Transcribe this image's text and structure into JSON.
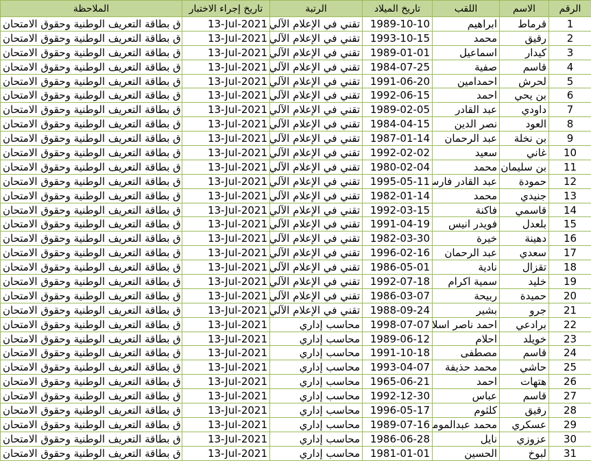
{
  "headers": {
    "note": "الملاحظة",
    "exam_date": "تاريخ إجراء الاختبار",
    "grade": "الرتبة",
    "birth_date": "تاريخ الميلاد",
    "surname": "اللقب",
    "name": "الاسم",
    "number": "الرقم"
  },
  "rows": [
    {
      "note": "ارفاق  بطاقة التعريف  الوطنية وحقوق الامتحان",
      "date": "13-Jul-2021",
      "grade": "تقني في الإعلام الآلي",
      "birth": "1989-10-10",
      "surname": "ابراهيم",
      "name": "قرماط",
      "num": "1"
    },
    {
      "note": "ارفاق  بطاقة التعريف  الوطنية وحقوق الامتحان",
      "date": "13-Jul-2021",
      "grade": "تقني في الإعلام الآلي",
      "birth": "1993-10-15",
      "surname": "محمد",
      "name": "رقيق",
      "num": "2"
    },
    {
      "note": "ارفاق  بطاقة التعريف  الوطنية وحقوق الامتحان",
      "date": "13-Jul-2021",
      "grade": "تقني في الإعلام الآلي",
      "birth": "1989-01-01",
      "surname": "اسماعيل",
      "name": "كيدار",
      "num": "3"
    },
    {
      "note": "ارفاق  بطاقة التعريف  الوطنية وحقوق الامتحان",
      "date": "13-Jul-2021",
      "grade": "تقني في الإعلام الآلي",
      "birth": "1984-07-25",
      "surname": "صفية",
      "name": "قاسم",
      "num": "4"
    },
    {
      "note": "ارفاق  بطاقة التعريف  الوطنية وحقوق الامتحان",
      "date": "13-Jul-2021",
      "grade": "تقني في الإعلام الآلي",
      "birth": "1991-06-20",
      "surname": "احمدامين",
      "name": "لحرش",
      "num": "5"
    },
    {
      "note": "ارفاق  بطاقة التعريف  الوطنية وحقوق الامتحان",
      "date": "13-Jul-2021",
      "grade": "تقني في الإعلام الآلي",
      "birth": "1992-06-15",
      "surname": "احمد",
      "name": "بن يحي",
      "num": "6"
    },
    {
      "note": "ارفاق  بطاقة التعريف  الوطنية وحقوق الامتحان",
      "date": "13-Jul-2021",
      "grade": "تقني في الإعلام الآلي",
      "birth": "1989-02-05",
      "surname": "عبد القادر",
      "name": "داودي",
      "num": "7"
    },
    {
      "note": "ارفاق  بطاقة التعريف  الوطنية وحقوق الامتحان",
      "date": "13-Jul-2021",
      "grade": "تقني في الإعلام الآلي",
      "birth": "1984-04-15",
      "surname": "نصر الدين",
      "name": "العود",
      "num": "8"
    },
    {
      "note": "ارفاق  بطاقة التعريف  الوطنية وحقوق الامتحان",
      "date": "13-Jul-2021",
      "grade": "تقني في الإعلام الآلي",
      "birth": "1987-01-14",
      "surname": "عبد الرحمان",
      "name": "بن نخلة",
      "num": "9"
    },
    {
      "note": "ارفاق  بطاقة التعريف  الوطنية وحقوق الامتحان",
      "date": "13-Jul-2021",
      "grade": "تقني في الإعلام الآلي",
      "birth": "1992-02-02",
      "surname": "سعيد",
      "name": "غاني",
      "num": "10"
    },
    {
      "note": "ارفاق  بطاقة التعريف  الوطنية وحقوق الامتحان",
      "date": "13-Jul-2021",
      "grade": "تقني في الإعلام الآلي",
      "birth": "1980-02-04",
      "surname": "محمد",
      "name": "بن سليمان",
      "num": "11"
    },
    {
      "note": "ارفاق  بطاقة التعريف  الوطنية وحقوق الامتحان",
      "date": "13-Jul-2021",
      "grade": "تقني في الإعلام الآلي",
      "birth": "1995-05-11",
      "surname": "عبد القادر فارس",
      "name": "حمودة",
      "num": "12"
    },
    {
      "note": "ارفاق  بطاقة التعريف  الوطنية وحقوق الامتحان",
      "date": "13-Jul-2021",
      "grade": "تقني في الإعلام الآلي",
      "birth": "1982-01-14",
      "surname": "محمد",
      "name": "جنيدي",
      "num": "13"
    },
    {
      "note": "ارفاق  بطاقة التعريف  الوطنية وحقوق الامتحان",
      "date": "13-Jul-2021",
      "grade": "تقني في الإعلام الآلي",
      "birth": "1992-03-15",
      "surname": "فاكنة",
      "name": "قاسمي",
      "num": "14"
    },
    {
      "note": "ارفاق  بطاقة التعريف  الوطنية وحقوق الامتحان",
      "date": "13-Jul-2021",
      "grade": "تقني في الإعلام الآلي",
      "birth": "1991-04-19",
      "surname": "فويدر  انيس",
      "name": "بلعدل",
      "num": "15"
    },
    {
      "note": "ارفاق  بطاقة التعريف  الوطنية وحقوق الامتحان",
      "date": "13-Jul-2021",
      "grade": "تقني في الإعلام الآلي",
      "birth": "1982-03-30",
      "surname": "خيرة",
      "name": "دهينة",
      "num": "16"
    },
    {
      "note": "ارفاق  بطاقة التعريف  الوطنية وحقوق الامتحان",
      "date": "13-Jul-2021",
      "grade": "تقني في الإعلام الآلي",
      "birth": "1996-02-16",
      "surname": "عبد الرحمان",
      "name": "سعدي",
      "num": "17"
    },
    {
      "note": "ارفاق  بطاقة التعريف  الوطنية وحقوق الامتحان",
      "date": "13-Jul-2021",
      "grade": "تقني في الإعلام الآلي",
      "birth": "1986-05-01",
      "surname": "نادية",
      "name": "تقزال",
      "num": "18"
    },
    {
      "note": "ارفاق  بطاقة التعريف  الوطنية وحقوق الامتحان",
      "date": "13-Jul-2021",
      "grade": "تقني في الإعلام الآلي",
      "birth": "1992-07-18",
      "surname": "سمية اكرام",
      "name": "خليد",
      "num": "19"
    },
    {
      "note": "ارفاق  بطاقة التعريف  الوطنية وحقوق الامتحان",
      "date": "13-Jul-2021",
      "grade": "تقني في الإعلام الآلي",
      "birth": "1986-03-07",
      "surname": "ربيحة",
      "name": "حميدة",
      "num": "20"
    },
    {
      "note": "ارفاق  بطاقة التعريف  الوطنية وحقوق الامتحان",
      "date": "13-Jul-2021",
      "grade": "تقني في الإعلام الآلي",
      "birth": "1988-09-24",
      "surname": "بشير",
      "name": "جرو",
      "num": "21"
    },
    {
      "note": "ارفاق  بطاقة التعريف  الوطنية وحقوق الامتحان",
      "date": "13-Jul-2021",
      "grade": "محاسب إداري",
      "birth": "1998-07-07",
      "surname": "احمد ناصر اسلام",
      "name": "برادعي",
      "num": "22"
    },
    {
      "note": "ارفاق  بطاقة التعريف  الوطنية وحقوق الامتحان",
      "date": "13-Jul-2021",
      "grade": "محاسب إداري",
      "birth": "1989-06-12",
      "surname": "احلام",
      "name": "خويلد",
      "num": "23"
    },
    {
      "note": "ارفاق  بطاقة التعريف  الوطنية وحقوق الامتحان",
      "date": "13-Jul-2021",
      "grade": "محاسب إداري",
      "birth": "1991-10-18",
      "surname": "مصطفى",
      "name": "قاسم",
      "num": "24"
    },
    {
      "note": "ارفاق  بطاقة التعريف  الوطنية وحقوق الامتحان",
      "date": "13-Jul-2021",
      "grade": "محاسب إداري",
      "birth": "1993-04-07",
      "surname": "محمد حذيفة",
      "name": "حاشي",
      "num": "25"
    },
    {
      "note": "ارفاق  بطاقة التعريف  الوطنية وحقوق الامتحان",
      "date": "13-Jul-2021",
      "grade": "محاسب إداري",
      "birth": "1965-06-21",
      "surname": "احمد",
      "name": "هتهات",
      "num": "26"
    },
    {
      "note": "ارفاق  بطاقة التعريف  الوطنية وحقوق الامتحان",
      "date": "13-Jul-2021",
      "grade": "محاسب إداري",
      "birth": "1992-12-30",
      "surname": "عباس",
      "name": "قاسم",
      "num": "27"
    },
    {
      "note": "ارفاق  بطاقة التعريف  الوطنية وحقوق الامتحان",
      "date": "13-Jul-2021",
      "grade": "محاسب إداري",
      "birth": "1996-05-17",
      "surname": "كلثوم",
      "name": "رقيق",
      "num": "28"
    },
    {
      "note": "ارفاق  بطاقة التعريف  الوطنية وحقوق الامتحان",
      "date": "13-Jul-2021",
      "grade": "محاسب إداري",
      "birth": "1989-07-16",
      "surname": "محمد عبدالمومن",
      "name": "عسكري",
      "num": "29"
    },
    {
      "note": "ارفاق  بطاقة التعريف  الوطنية وحقوق الامتحان",
      "date": "13-Jul-2021",
      "grade": "محاسب إداري",
      "birth": "1986-06-28",
      "surname": "نايل",
      "name": "عزوزي",
      "num": "30"
    },
    {
      "note": "ارفاق  بطاقة التعريف  الوطنية وحقوق الامتحان",
      "date": "13-Jul-2021",
      "grade": "محاسب إداري",
      "birth": "1981-01-01",
      "surname": "الحسين",
      "name": "لبوخ",
      "num": "31"
    }
  ]
}
